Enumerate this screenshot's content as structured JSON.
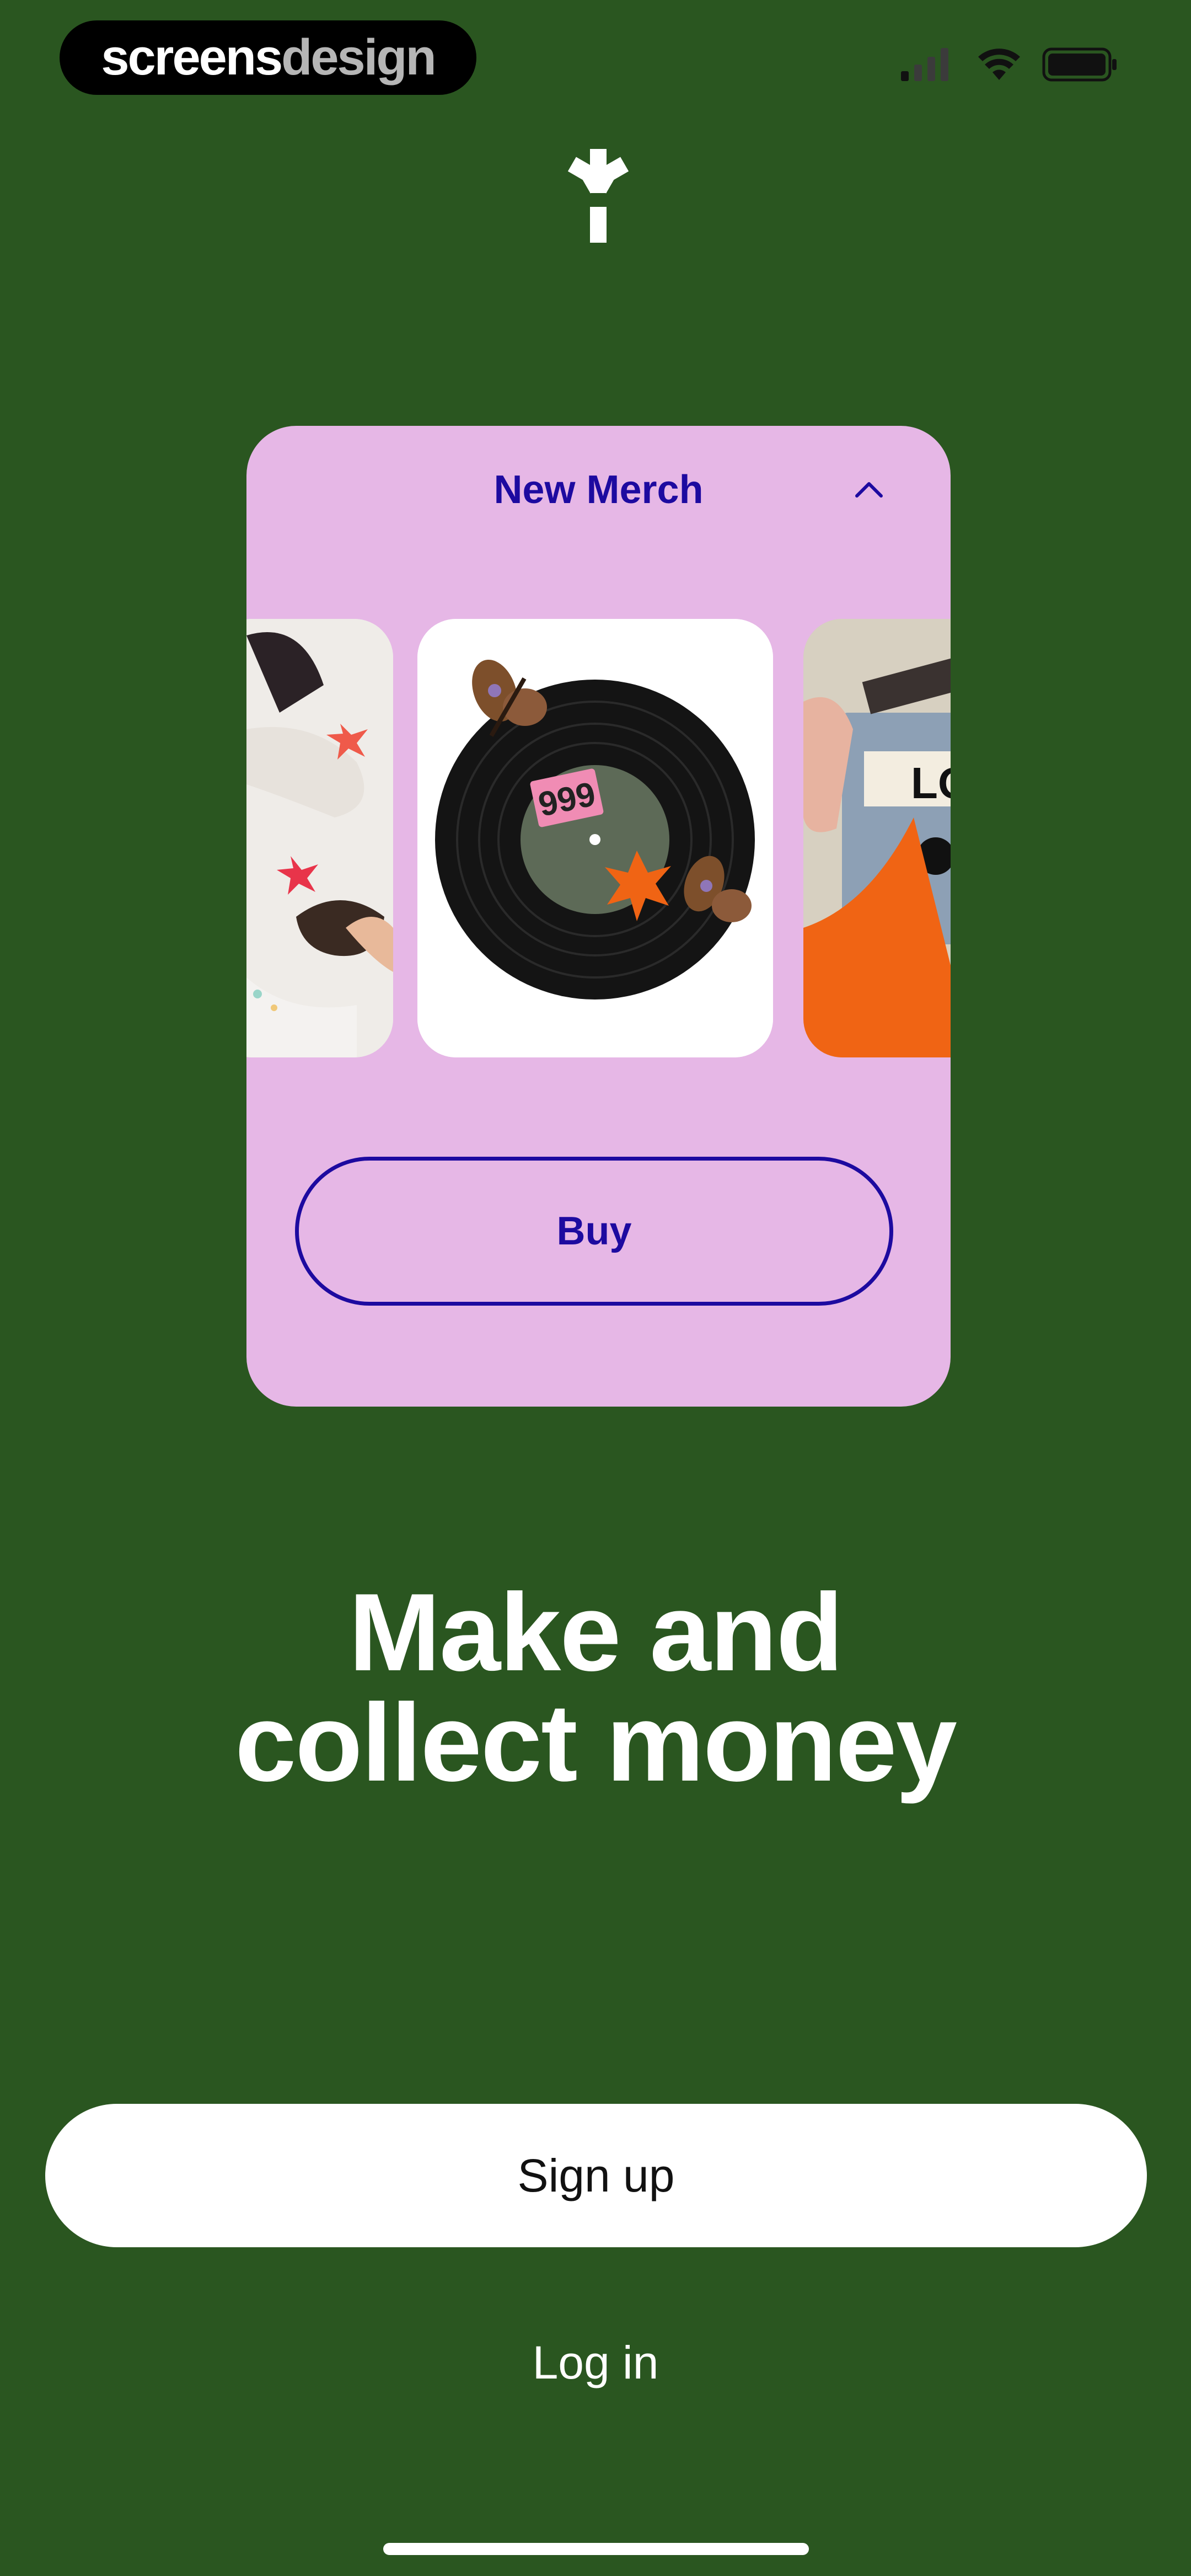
{
  "watermark": {
    "part1": "screens",
    "part2": "design"
  },
  "status_bar": {
    "signal_icon": "cellular-signal-icon",
    "wifi_icon": "wifi-icon",
    "battery_icon": "battery-icon"
  },
  "brand": {
    "logo_icon": "asterisk-logo-icon"
  },
  "card": {
    "title": "New Merch",
    "collapse_icon": "chevron-up-icon",
    "buy_label": "Buy",
    "thumbnails": [
      "person-sleeping-thumbnail",
      "vinyl-record-thumbnail",
      "cassette-tape-thumbnail"
    ]
  },
  "headline": {
    "line1": "Make and",
    "line2": "collect money"
  },
  "actions": {
    "signup_label": "Sign up",
    "login_label": "Log in"
  },
  "colors": {
    "background": "#2a5620",
    "card": "#e6b7e6",
    "accent": "#1d0aa0",
    "orange": "#f06414"
  }
}
